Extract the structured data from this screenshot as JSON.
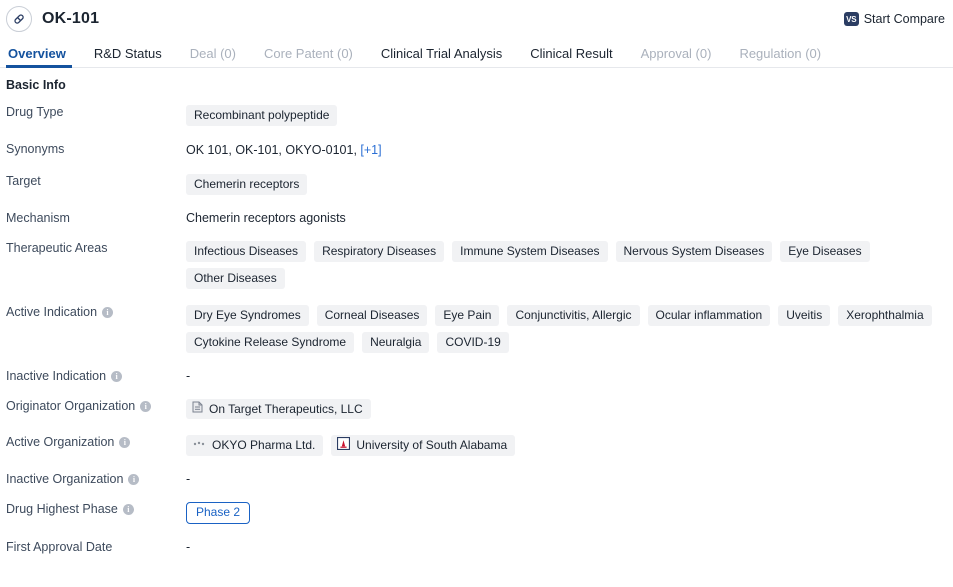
{
  "header": {
    "drug_icon": "capsule-icon",
    "title": "OK-101",
    "compare": {
      "badge": "VS",
      "label": "Start Compare"
    }
  },
  "tabs": [
    {
      "label": "Overview",
      "state": "active"
    },
    {
      "label": "R&D Status",
      "state": "normal"
    },
    {
      "label": "Deal (0)",
      "state": "disabled"
    },
    {
      "label": "Core Patent (0)",
      "state": "disabled"
    },
    {
      "label": "Clinical Trial Analysis",
      "state": "normal"
    },
    {
      "label": "Clinical Result",
      "state": "normal"
    },
    {
      "label": "Approval (0)",
      "state": "disabled"
    },
    {
      "label": "Regulation (0)",
      "state": "disabled"
    }
  ],
  "section": {
    "title": "Basic Info"
  },
  "rows": {
    "drug_type": {
      "label": "Drug Type",
      "tags": [
        "Recombinant polypeptide"
      ]
    },
    "synonyms": {
      "label": "Synonyms",
      "text": "OK 101,  OK-101,  OKYO-0101, ",
      "more_link": "[+1]"
    },
    "target": {
      "label": "Target",
      "tags": [
        "Chemerin receptors"
      ]
    },
    "mechanism": {
      "label": "Mechanism",
      "text": "Chemerin receptors agonists"
    },
    "therapeutic_areas": {
      "label": "Therapeutic Areas",
      "tags": [
        "Infectious Diseases",
        "Respiratory Diseases",
        "Immune System Diseases",
        "Nervous System Diseases",
        "Eye Diseases",
        "Other Diseases"
      ]
    },
    "active_indication": {
      "label": "Active Indication",
      "has_info": true,
      "tags": [
        "Dry Eye Syndromes",
        "Corneal Diseases",
        "Eye Pain",
        "Conjunctivitis, Allergic",
        "Ocular inflammation",
        "Uveitis",
        "Xerophthalmia",
        "Cytokine Release Syndrome",
        "Neuralgia",
        "COVID-19"
      ]
    },
    "inactive_indication": {
      "label": "Inactive Indication",
      "has_info": true,
      "text": "-"
    },
    "originator_organization": {
      "label": "Originator Organization",
      "has_info": true,
      "orgs": [
        {
          "name": "On Target Therapeutics, LLC",
          "logo": "document-logo-icon"
        }
      ]
    },
    "active_organization": {
      "label": "Active Organization",
      "has_info": true,
      "orgs": [
        {
          "name": "OKYO Pharma Ltd.",
          "logo": "okyo-dots-logo-icon"
        },
        {
          "name": "University of South Alabama",
          "logo": "usa-crest-logo-icon"
        }
      ]
    },
    "inactive_organization": {
      "label": "Inactive Organization",
      "has_info": true,
      "text": "-"
    },
    "drug_highest_phase": {
      "label": "Drug Highest Phase",
      "has_info": true,
      "badge": "Phase 2"
    },
    "first_approval_date": {
      "label": "First Approval Date",
      "text": "-"
    }
  },
  "colors": {
    "accent": "#14529e",
    "link": "#2b6fd4",
    "tag_bg": "#f1f2f4",
    "phase_border": "#1a62c4",
    "vs_badge": "#2b3d63"
  }
}
